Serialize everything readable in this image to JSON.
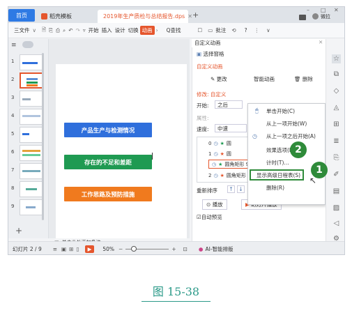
{
  "tabs": {
    "home": "首页",
    "template": "稻壳模板",
    "doc": "2019年生产质检与总结报告.dps",
    "user": "微拉"
  },
  "menu": {
    "file": "三文件",
    "items": [
      "开始",
      "插入",
      "设计",
      "切换",
      "动画"
    ],
    "search": "Q查找",
    "comment": "批注",
    "help": "?"
  },
  "thumbs": [
    "1",
    "2",
    "3",
    "4",
    "5",
    "6",
    "7",
    "8",
    "9"
  ],
  "slide": {
    "btn1": "产品生产与检测情况",
    "btn2": "存在的不足和差距",
    "btn3": "工作思路及预防措施"
  },
  "notes": "单击此处添加备注",
  "panel": {
    "title": "自定义动画",
    "select_pane": "选择窗格",
    "section": "自定义动画",
    "change": "更改",
    "smart": "智能动画",
    "delete": "删除",
    "modify": "修改: 自定义",
    "start_label": "开始:",
    "start_value": "之后",
    "prop_label": "属性:",
    "speed_label": "速度:",
    "speed_value": "中速",
    "reorder": "重新排序",
    "play": "播放",
    "slideshow": "幻灯片播放",
    "autopreview": "自动预览",
    "list": [
      {
        "num": "0",
        "text": "圆"
      },
      {
        "num": "1",
        "text": "圆"
      },
      {
        "num": "",
        "text": "圆角矩形 9: 存在的不足和差距"
      },
      {
        "num": "2",
        "text": "圆角矩形 9: 存在的不足和差距"
      }
    ]
  },
  "context_menu": [
    "单击开始(C)",
    "从上一项开始(W)",
    "从上一项之后开始(A)",
    "效果选项(E)...",
    "计时(T)...",
    "显示高级日程表(S)",
    "删除(R)"
  ],
  "status": {
    "slide_count": "幻灯片 2 / 9",
    "zoom": "50%",
    "ai": "AI-智能排版"
  },
  "callouts": [
    "2",
    "1"
  ],
  "caption": "图 15-38",
  "colors": {
    "accent": "#e5562d",
    "blue_button": "#2f6fdc",
    "green_button": "#1f9a52",
    "orange_button": "#f07a1e",
    "callout": "#2f8b3a",
    "caption": "#2c9a89"
  }
}
